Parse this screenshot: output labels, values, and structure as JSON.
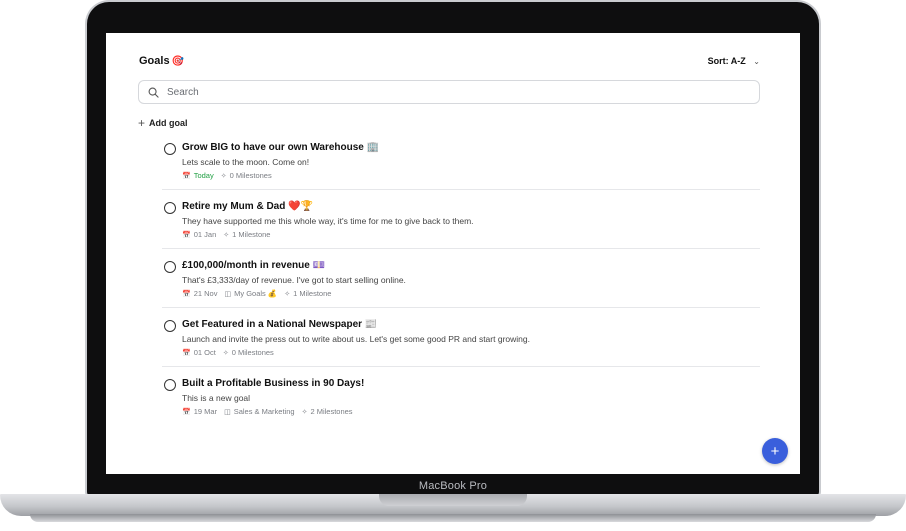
{
  "device": {
    "label": "MacBook Pro"
  },
  "header": {
    "title": "Goals",
    "title_emoji": "🎯",
    "sort_label": "Sort: A-Z"
  },
  "search": {
    "placeholder": "Search"
  },
  "add_goal": {
    "label": "Add goal"
  },
  "goals": [
    {
      "title": "Grow BIG to have our own Warehouse 🏢",
      "description": "Lets scale to the moon. Come on!",
      "date": "Today",
      "tag": "",
      "milestones": "0 Milestones"
    },
    {
      "title": "Retire my Mum & Dad ❤️🏆",
      "description": "They have supported me this whole way, it's time for me to give back to them.",
      "date": "01 Jan",
      "tag": "",
      "milestones": "1 Milestone"
    },
    {
      "title": "£100,000/month in revenue 💷",
      "description": "That's £3,333/day of revenue. I've got to start selling online.",
      "date": "21 Nov",
      "tag": "My Goals 💰",
      "milestones": "1 Milestone"
    },
    {
      "title": "Get Featured in a National Newspaper 📰",
      "description": "Launch and invite the press out to write about us. Let's get some good PR and start growing.",
      "date": "01 Oct",
      "tag": "",
      "milestones": "0 Milestones"
    },
    {
      "title": "Built a Profitable Business in 90 Days!",
      "description": "This is a new goal",
      "date": "19 Mar",
      "tag": "Sales & Marketing",
      "milestones": "2 Milestones"
    }
  ],
  "fab": {
    "label": "+"
  },
  "colors": {
    "accent": "#3a5fdc",
    "today": "#22a044"
  }
}
